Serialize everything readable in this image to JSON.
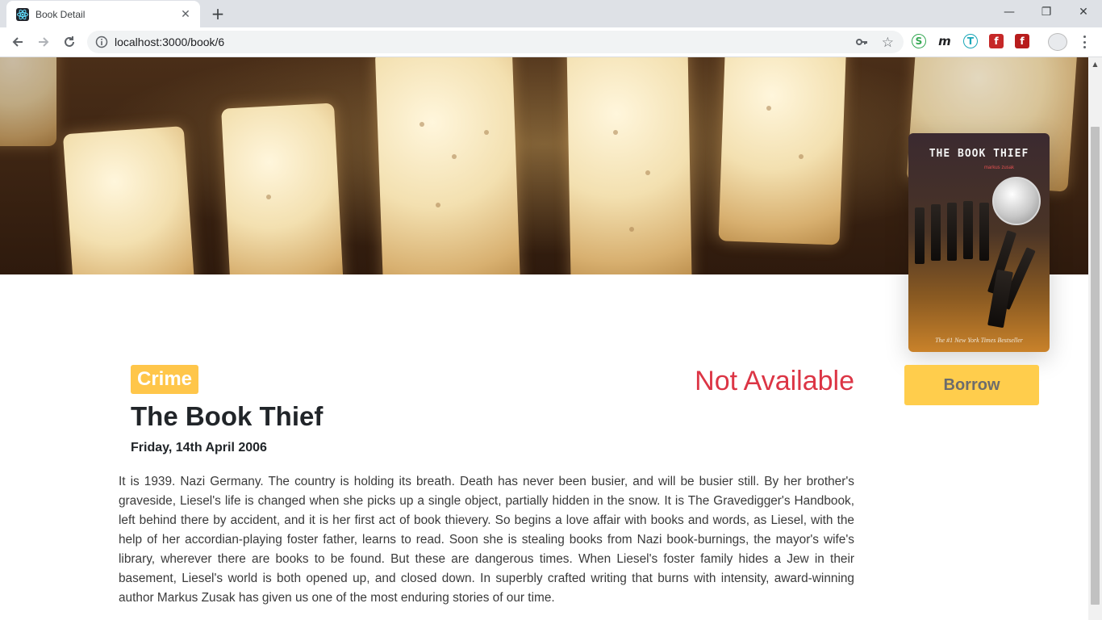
{
  "browser": {
    "tab_title": "Book Detail",
    "new_tab": "+",
    "url": "localhost:3000/book/6",
    "controls": {
      "minimize": "—",
      "restore": "❐",
      "close": "✕"
    },
    "extensions": [
      "stackshare-icon",
      "m-icon",
      "torrent-icon",
      "flash-icon",
      "flash-red-icon"
    ]
  },
  "book": {
    "genre": "Crime",
    "availability": "Not Available",
    "title": "The Book Thief",
    "published": "Friday, 14th April 2006",
    "description": "It is 1939. Nazi Germany. The country is holding its breath. Death has never been busier, and will be busier still. By her brother's graveside, Liesel's life is changed when she picks up a single object, partially hidden in the snow. It is The Gravedigger's Handbook, left behind there by accident, and it is her first act of book thievery. So begins a love affair with books and words, as Liesel, with the help of her accordian-playing foster father, learns to read. Soon she is stealing books from Nazi book-burnings, the mayor's wife's library, wherever there are books to be found. But these are dangerous times. When Liesel's foster family hides a Jew in their basement, Liesel's world is both opened up, and closed down. In superbly crafted writing that burns with intensity, award-winning author Markus Zusak has given us one of the most enduring stories of our time.",
    "cover": {
      "title": "THE BOOK THIEF",
      "author": "markus zusak",
      "tagline": "The #1 New York Times Bestseller"
    }
  },
  "actions": {
    "borrow_label": "Borrow"
  },
  "colors": {
    "genre_badge": "#ffc64a",
    "status_unavailable": "#dc3545",
    "borrow_button": "#ffcd4c"
  }
}
